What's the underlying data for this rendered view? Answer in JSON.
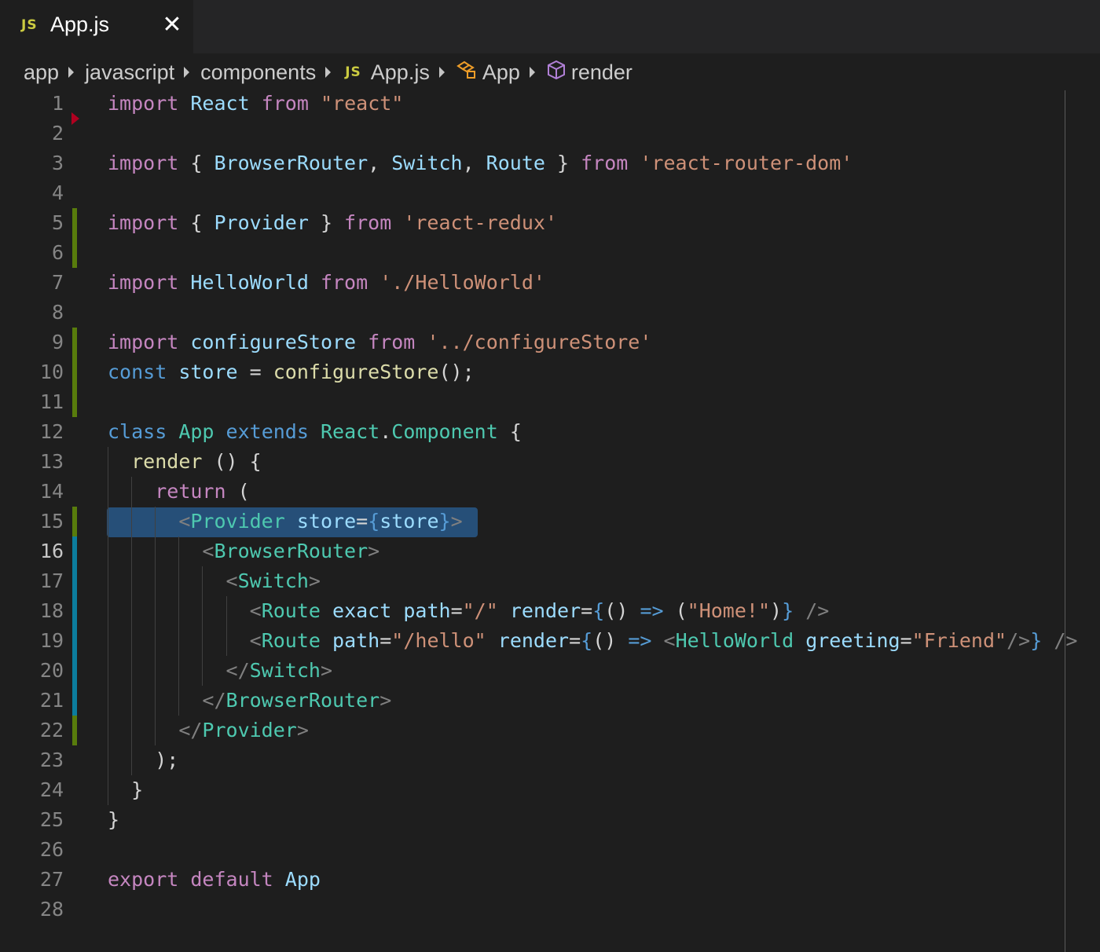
{
  "tab": {
    "lang_badge": "JS",
    "filename": "App.js",
    "close_glyph": "✕"
  },
  "breadcrumbs": [
    {
      "label": "app"
    },
    {
      "label": "javascript"
    },
    {
      "label": "components"
    },
    {
      "label": "App.js",
      "badge": "JS"
    },
    {
      "label": "App",
      "icon": "class-icon"
    },
    {
      "label": "render",
      "icon": "method-cube-icon"
    }
  ],
  "editor": {
    "active_line": 16,
    "modified_lines": [
      5,
      6,
      9,
      10,
      11,
      15,
      22
    ],
    "added_lines": [
      16,
      17,
      18,
      19,
      20,
      21
    ],
    "line_numbers": [
      "1",
      "2",
      "3",
      "4",
      "5",
      "6",
      "7",
      "8",
      "9",
      "10",
      "11",
      "12",
      "13",
      "14",
      "15",
      "16",
      "17",
      "18",
      "19",
      "20",
      "21",
      "22",
      "23",
      "24",
      "25",
      "26",
      "27",
      "28"
    ],
    "lines": [
      [
        [
          "import",
          "key"
        ],
        [
          " ",
          "pun"
        ],
        [
          "React",
          "var"
        ],
        [
          " ",
          "pun"
        ],
        [
          "from",
          "key"
        ],
        [
          " ",
          "pun"
        ],
        [
          "\"react\"",
          "str"
        ]
      ],
      [],
      [
        [
          "import",
          "key"
        ],
        [
          " { ",
          "pun"
        ],
        [
          "BrowserRouter",
          "var"
        ],
        [
          ", ",
          "pun"
        ],
        [
          "Switch",
          "var"
        ],
        [
          ", ",
          "pun"
        ],
        [
          "Route",
          "var"
        ],
        [
          " } ",
          "pun"
        ],
        [
          "from",
          "key"
        ],
        [
          " ",
          "pun"
        ],
        [
          "'react-router-dom'",
          "str"
        ]
      ],
      [],
      [
        [
          "import",
          "key"
        ],
        [
          " { ",
          "pun"
        ],
        [
          "Provider",
          "var"
        ],
        [
          " } ",
          "pun"
        ],
        [
          "from",
          "key"
        ],
        [
          " ",
          "pun"
        ],
        [
          "'react-redux'",
          "str"
        ]
      ],
      [],
      [
        [
          "import",
          "key"
        ],
        [
          " ",
          "pun"
        ],
        [
          "HelloWorld",
          "var"
        ],
        [
          " ",
          "pun"
        ],
        [
          "from",
          "key"
        ],
        [
          " ",
          "pun"
        ],
        [
          "'./HelloWorld'",
          "str"
        ]
      ],
      [],
      [
        [
          "import",
          "key"
        ],
        [
          " ",
          "pun"
        ],
        [
          "configureStore",
          "var"
        ],
        [
          " ",
          "pun"
        ],
        [
          "from",
          "key"
        ],
        [
          " ",
          "pun"
        ],
        [
          "'../configureStore'",
          "str"
        ]
      ],
      [
        [
          "const",
          "dec"
        ],
        [
          " ",
          "pun"
        ],
        [
          "store",
          "var"
        ],
        [
          " = ",
          "pun"
        ],
        [
          "configureStore",
          "fn"
        ],
        [
          "();",
          "pun"
        ]
      ],
      [],
      [
        [
          "class",
          "dec"
        ],
        [
          " ",
          "pun"
        ],
        [
          "App",
          "cls"
        ],
        [
          " ",
          "pun"
        ],
        [
          "extends",
          "dec"
        ],
        [
          " ",
          "pun"
        ],
        [
          "React",
          "cls"
        ],
        [
          ".",
          "pun"
        ],
        [
          "Component",
          "cls"
        ],
        [
          " {",
          "pun"
        ]
      ],
      [
        [
          "  ",
          "pun"
        ],
        [
          "render",
          "fn"
        ],
        [
          " () {",
          "pun"
        ]
      ],
      [
        [
          "    ",
          "pun"
        ],
        [
          "return",
          "key"
        ],
        [
          " (",
          "pun"
        ]
      ],
      [
        [
          "      ",
          "pun"
        ],
        [
          "<",
          "tag"
        ],
        [
          "Provider",
          "cls"
        ],
        [
          " ",
          "pun"
        ],
        [
          "store",
          "var"
        ],
        [
          "=",
          "pun"
        ],
        [
          "{",
          "brc"
        ],
        [
          "store",
          "var"
        ],
        [
          "}",
          "brc"
        ],
        [
          ">",
          "tag"
        ]
      ],
      [
        [
          "        ",
          "pun"
        ],
        [
          "<",
          "tag"
        ],
        [
          "BrowserRouter",
          "cls"
        ],
        [
          ">",
          "tag"
        ]
      ],
      [
        [
          "          ",
          "pun"
        ],
        [
          "<",
          "tag"
        ],
        [
          "Switch",
          "cls"
        ],
        [
          ">",
          "tag"
        ]
      ],
      [
        [
          "            ",
          "pun"
        ],
        [
          "<",
          "tag"
        ],
        [
          "Route",
          "cls"
        ],
        [
          " ",
          "pun"
        ],
        [
          "exact",
          "var"
        ],
        [
          " ",
          "pun"
        ],
        [
          "path",
          "var"
        ],
        [
          "=",
          "pun"
        ],
        [
          "\"/\"",
          "str"
        ],
        [
          " ",
          "pun"
        ],
        [
          "render",
          "var"
        ],
        [
          "=",
          "pun"
        ],
        [
          "{",
          "brc"
        ],
        [
          "() ",
          "pun"
        ],
        [
          "=>",
          "dec"
        ],
        [
          " (",
          "pun"
        ],
        [
          "\"Home!\"",
          "str"
        ],
        [
          ")",
          "pun"
        ],
        [
          "}",
          "brc"
        ],
        [
          " ",
          "pun"
        ],
        [
          "/>",
          "tag"
        ]
      ],
      [
        [
          "            ",
          "pun"
        ],
        [
          "<",
          "tag"
        ],
        [
          "Route",
          "cls"
        ],
        [
          " ",
          "pun"
        ],
        [
          "path",
          "var"
        ],
        [
          "=",
          "pun"
        ],
        [
          "\"/hello\"",
          "str"
        ],
        [
          " ",
          "pun"
        ],
        [
          "render",
          "var"
        ],
        [
          "=",
          "pun"
        ],
        [
          "{",
          "brc"
        ],
        [
          "() ",
          "pun"
        ],
        [
          "=>",
          "dec"
        ],
        [
          " ",
          "pun"
        ],
        [
          "<",
          "tag"
        ],
        [
          "HelloWorld",
          "cls"
        ],
        [
          " ",
          "pun"
        ],
        [
          "greeting",
          "var"
        ],
        [
          "=",
          "pun"
        ],
        [
          "\"Friend\"",
          "str"
        ],
        [
          "/>",
          "tag"
        ],
        [
          "}",
          "brc"
        ],
        [
          " ",
          "pun"
        ],
        [
          "/>",
          "tag"
        ]
      ],
      [
        [
          "          ",
          "pun"
        ],
        [
          "</",
          "tag"
        ],
        [
          "Switch",
          "cls"
        ],
        [
          ">",
          "tag"
        ]
      ],
      [
        [
          "        ",
          "pun"
        ],
        [
          "</",
          "tag"
        ],
        [
          "BrowserRouter",
          "cls"
        ],
        [
          ">",
          "tag"
        ]
      ],
      [
        [
          "      ",
          "pun"
        ],
        [
          "</",
          "tag"
        ],
        [
          "Provider",
          "cls"
        ],
        [
          ">",
          "tag"
        ]
      ],
      [
        [
          "    ",
          "pun"
        ],
        [
          ");",
          "pun"
        ]
      ],
      [
        [
          "  ",
          "pun"
        ],
        [
          "}",
          "pun"
        ]
      ],
      [
        [
          "}",
          "pun"
        ]
      ],
      [],
      [
        [
          "export",
          "key"
        ],
        [
          " ",
          "pun"
        ],
        [
          "default",
          "key"
        ],
        [
          " ",
          "pun"
        ],
        [
          "App",
          "var"
        ]
      ],
      []
    ]
  },
  "colors": {
    "modified_bar": "#587c0c",
    "added_bar": "#0c7d9d",
    "selection": "#264f78"
  }
}
